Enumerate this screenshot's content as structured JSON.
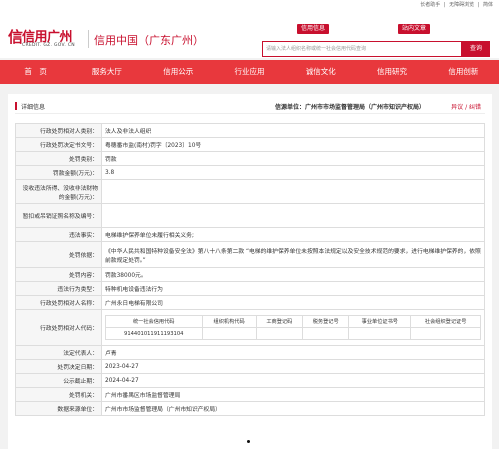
{
  "top": {
    "links": [
      "长者助手",
      "|",
      "无障碍浏览",
      "|",
      "简体"
    ]
  },
  "header": {
    "logo_mark": "信",
    "logo_text": "信用广州",
    "logo_sub": "CREDIT. GZ. GOV. CN",
    "site_name": "信用中国（广东广州）",
    "tab1": "信用信息",
    "tab2": "站内文章",
    "search_placeholder": "请输入法人组织名称或统一社会信用代码查询",
    "search_button": "查询"
  },
  "nav": [
    "首　页",
    "服务大厅",
    "信用公示",
    "行业应用",
    "诚信文化",
    "信用研究",
    "信用创新"
  ],
  "panel": {
    "title": "详细信息",
    "source": "信源单位：广州市市场监督管理局（广州市知识产权局）",
    "objection": "异议 / 纠错"
  },
  "fields": [
    {
      "k": "行政处罚相对人类别：",
      "v": "法人及非法人组织"
    },
    {
      "k": "行政处罚决定书文号：",
      "v": "粤穗番市监(南村)罚字〔2023〕10号"
    },
    {
      "k": "处罚类别：",
      "v": "罚款"
    },
    {
      "k": "罚款金额(万元)：",
      "v": "3.8"
    },
    {
      "k": "没收违法所得、没收非法财物的金额(万元)：",
      "v": ""
    },
    {
      "k": "暂扣或吊销证照名称及编号：",
      "v": ""
    },
    {
      "k": "违法事实：",
      "v": "电梯维护保养单位未履行相关义务;"
    },
    {
      "k": "处罚依据：",
      "v": "《中华人民共和国特种设备安全法》第八十八条第二款 “电梯的维护保养单位未按照本法规定以及安全技术规范的要求，进行电梯维护保养的，依照前款规定处罚。”"
    },
    {
      "k": "处罚内容：",
      "v": "罚款38000元。"
    },
    {
      "k": "违法行为类型：",
      "v": "特种机电设备违法行为"
    },
    {
      "k": "行政处罚相对人名称：",
      "v": "广州永日电梯有限公司"
    }
  ],
  "codes": {
    "label": "行政处罚相对人代码：",
    "headers": [
      "统一社会信用代码",
      "组织机构代码",
      "工商登记码",
      "税务登记号",
      "事业单位证书号",
      "社会组织登记证号"
    ],
    "values": [
      "914401011911193104",
      "",
      "",
      "",
      "",
      ""
    ]
  },
  "fields2": [
    {
      "k": "法定代表人：",
      "v": "卢青"
    },
    {
      "k": "处罚决定日期：",
      "v": "2023-04-27"
    },
    {
      "k": "公示截止期：",
      "v": "2024-04-27"
    },
    {
      "k": "处罚机关：",
      "v": "广州市番禺区市场监督管理局"
    },
    {
      "k": "数据来源单位：",
      "v": "广州市市场监督管理局（广州市知识产权局）"
    }
  ]
}
